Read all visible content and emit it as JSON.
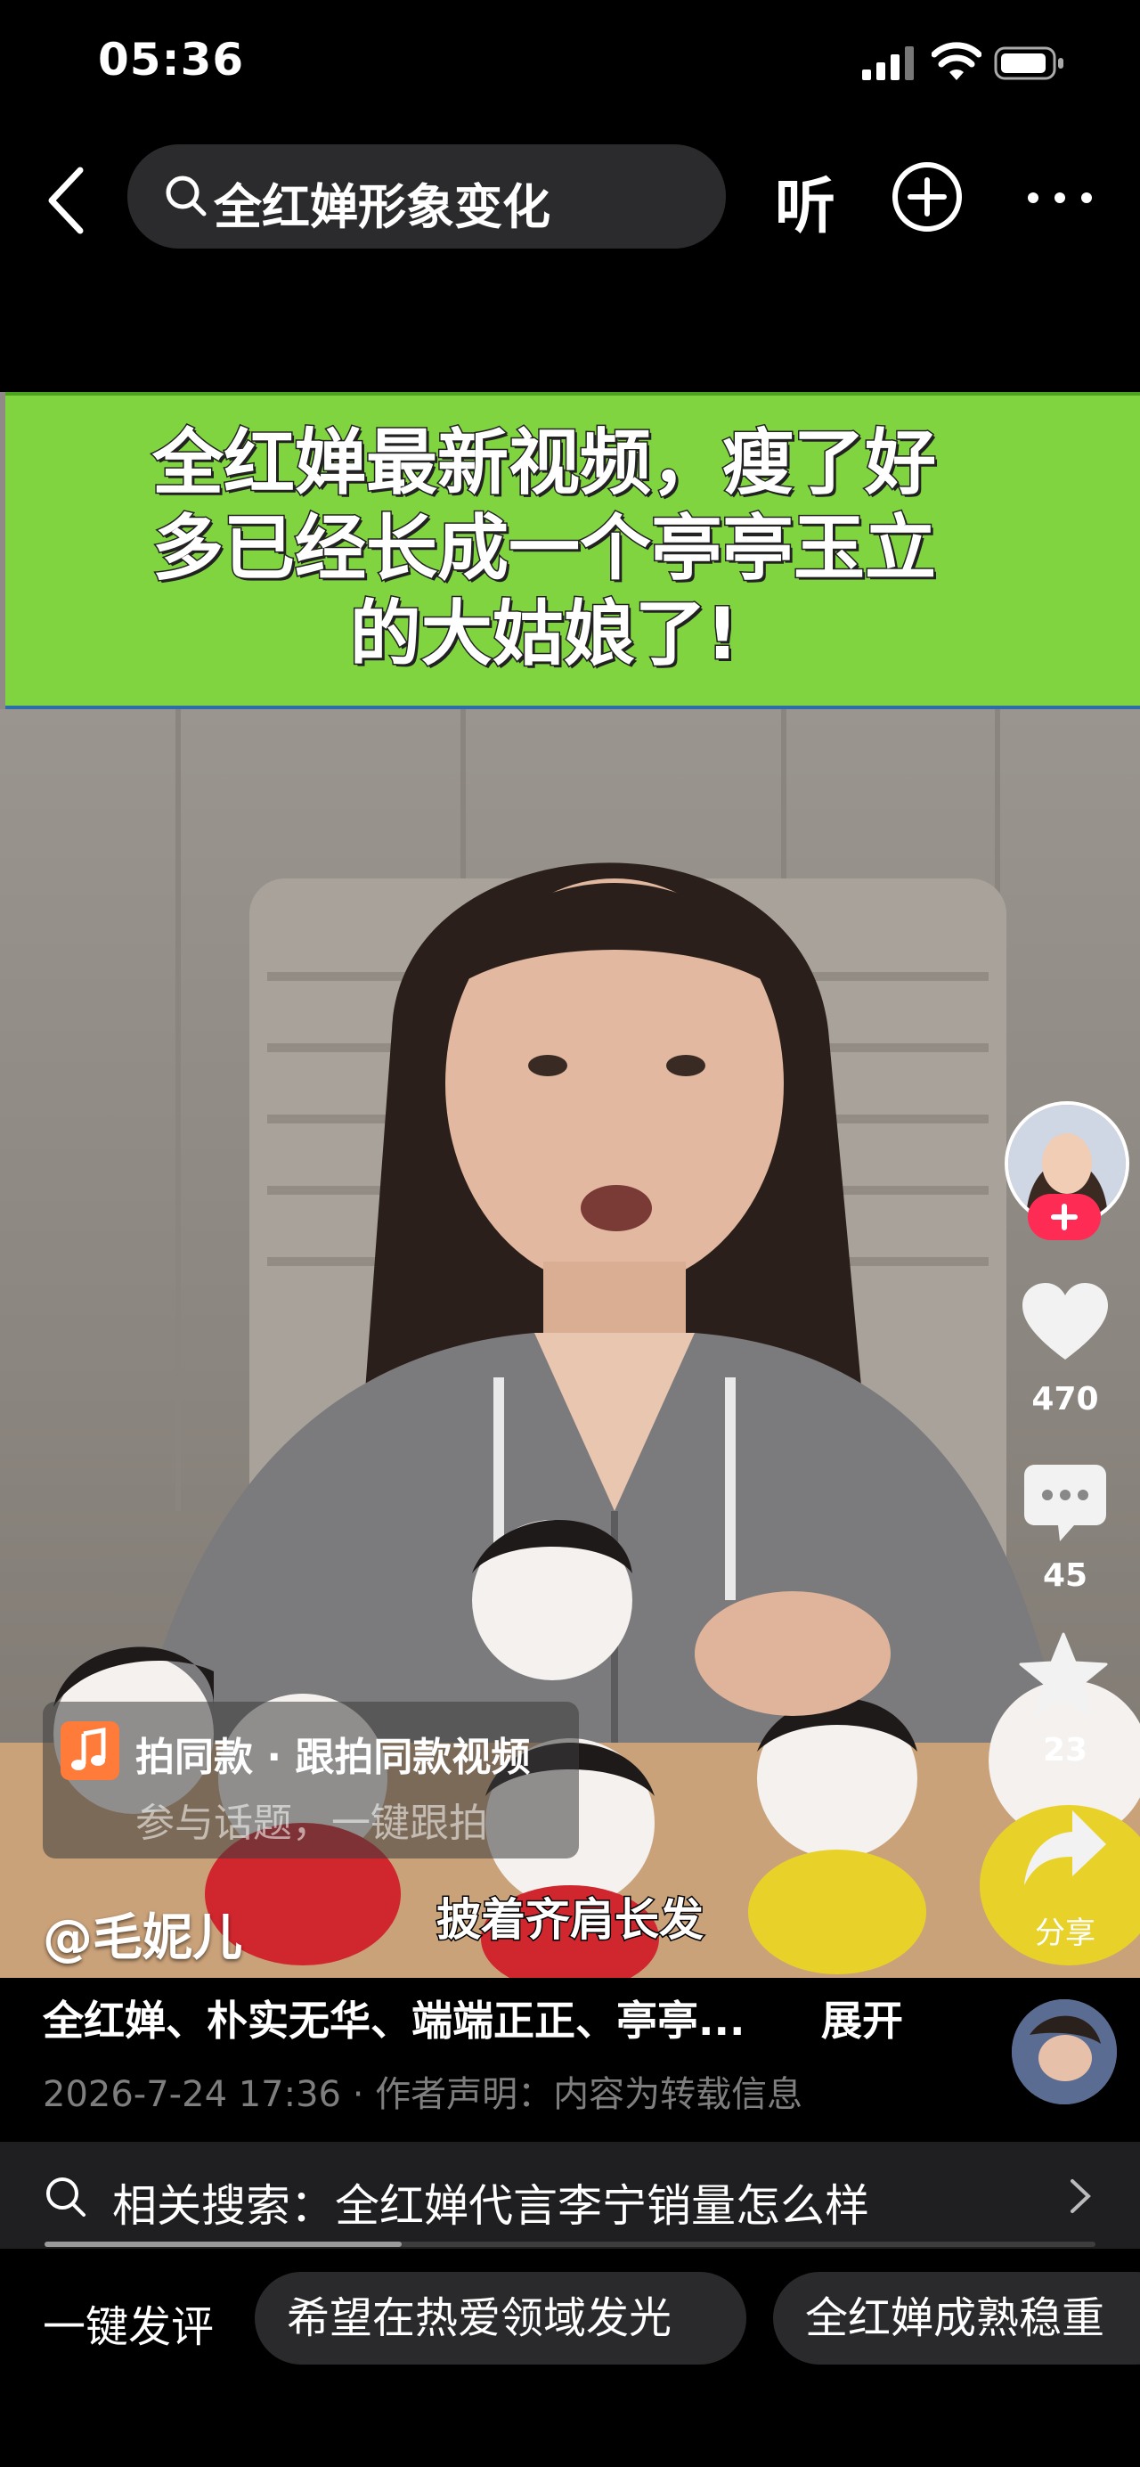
{
  "status_bar": {
    "time": "05:36"
  },
  "nav": {
    "search_query": "全红婵形象变化",
    "listen_label": "听"
  },
  "video": {
    "banner_lines": [
      "全红婵最新视频，瘦了好",
      "多已经长成一个亭亭玉立",
      "的大姑娘了!"
    ],
    "caption": "披着齐肩长发",
    "author": "@毛妮儿"
  },
  "actions": {
    "likes": "470",
    "comments": "45",
    "favorites": "23",
    "share_label": "分享"
  },
  "same_style": {
    "title": "拍同款 · 跟拍同款视频",
    "subtitle": "参与话题，一键跟拍"
  },
  "description": {
    "text": "全红婵、朴实无华、端端正正、亭亭...",
    "expand_label": "展开",
    "meta": "2026-7-24 17:36 · 作者声明：内容为转载信息"
  },
  "related_search": {
    "text": "相关搜索：全红婵代言李宁销量怎么样",
    "progress": 0.34
  },
  "quick_comments": {
    "label": "一键发评",
    "chips": [
      "希望在热爱领域发光",
      "全红婵成熟稳重"
    ]
  },
  "colors": {
    "banner_green": "#7fd440",
    "follow_red": "#fe2c55",
    "music_orange": "#ff7b3a"
  }
}
